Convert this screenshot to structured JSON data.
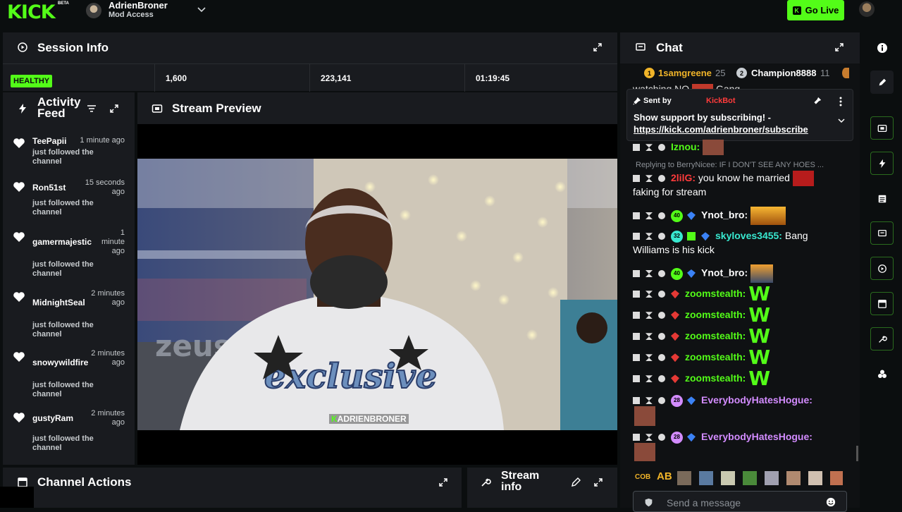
{
  "topbar": {
    "logo": "KICK",
    "logo_badge": "BETA",
    "channel_name": "AdrienBroner",
    "channel_role": "Mod Access",
    "go_live": "Go Live"
  },
  "session": {
    "title": "Session Info",
    "health": "HEALTHY",
    "stats": [
      "1,600",
      "223,141",
      "01:19:45"
    ]
  },
  "activity": {
    "title_line1": "Activity",
    "title_line2": "Feed",
    "items": [
      {
        "user": "TeePapii",
        "time": "1 minute ago",
        "desc": "just followed the channel"
      },
      {
        "user": "Ron51st",
        "time": "15 seconds ago",
        "desc": "just followed the channel"
      },
      {
        "user": "gamermajestic",
        "time": "1 minute ago",
        "desc": "just followed the channel"
      },
      {
        "user": "MidnightSeal",
        "time": "2 minutes ago",
        "desc": "just followed the channel"
      },
      {
        "user": "snowywildfire",
        "time": "2 minutes ago",
        "desc": "just followed the channel"
      },
      {
        "user": "gustyRam",
        "time": "2 minutes ago",
        "desc": "just followed the channel"
      }
    ]
  },
  "preview": {
    "title": "Stream Preview",
    "tag": "ADRIENBRONER",
    "banner_text": "zeus",
    "shirt_text": "exclusive"
  },
  "actions": {
    "title": "Channel Actions"
  },
  "stream_info": {
    "title_line1": "Stream",
    "title_line2": "info"
  },
  "chat": {
    "title": "Chat",
    "leaders": [
      {
        "rank": "1",
        "name": "1samgreene",
        "count": "25"
      },
      {
        "rank": "2",
        "name": "Champion8888",
        "count": "11"
      }
    ],
    "partial_line": "watching NO",
    "partial_line_tail": "Gang",
    "pinned": {
      "sent_by_label": "Sent by",
      "sender": "KickBot",
      "message": "Show support by subscribing! -",
      "link": "https://kick.com/adrienbroner/subscribe"
    },
    "reply_to": "Replying to BerryNicee: IF I DON'T SEE ANY HOES ...",
    "messages": [
      {
        "user": "Iznou:",
        "text": "",
        "badge": "",
        "color": "#53fc18"
      },
      {
        "user": "2lilG:",
        "text": " you know he married",
        "text2": "faking for stream",
        "badge": "",
        "color": "#ff3b3b"
      },
      {
        "user": "Ynot_bro:",
        "text": "",
        "badge": "40",
        "color": "#ffffff"
      },
      {
        "user": "skyloves3455:",
        "text": " Bang",
        "text2": "Williams is his kick",
        "badge": "32",
        "color": "#38e8d0"
      },
      {
        "user": "Ynot_bro:",
        "text": "",
        "badge": "40",
        "color": "#ffffff"
      },
      {
        "user": "zoomstealth:",
        "text": "",
        "badge": "",
        "color": "#53fc18",
        "emote": "W"
      },
      {
        "user": "zoomstealth:",
        "text": "",
        "badge": "",
        "color": "#53fc18",
        "emote": "W"
      },
      {
        "user": "zoomstealth:",
        "text": "",
        "badge": "",
        "color": "#53fc18",
        "emote": "W"
      },
      {
        "user": "zoomstealth:",
        "text": "",
        "badge": "",
        "color": "#53fc18",
        "emote": "W"
      },
      {
        "user": "zoomstealth:",
        "text": "",
        "badge": "",
        "color": "#53fc18",
        "emote": "W"
      },
      {
        "user": "EverybodyHatesHogue:",
        "text": "",
        "badge": "28",
        "color": "#d38cff"
      },
      {
        "user": "EverybodyHatesHogue:",
        "text": "",
        "badge": "28",
        "color": "#d38cff"
      }
    ],
    "emote_bar": [
      "COB",
      "AB"
    ],
    "input_placeholder": "Send a message"
  },
  "colors": {
    "accent": "#53fc18",
    "panel": "#191b1f",
    "background": "#0b0e0f"
  }
}
